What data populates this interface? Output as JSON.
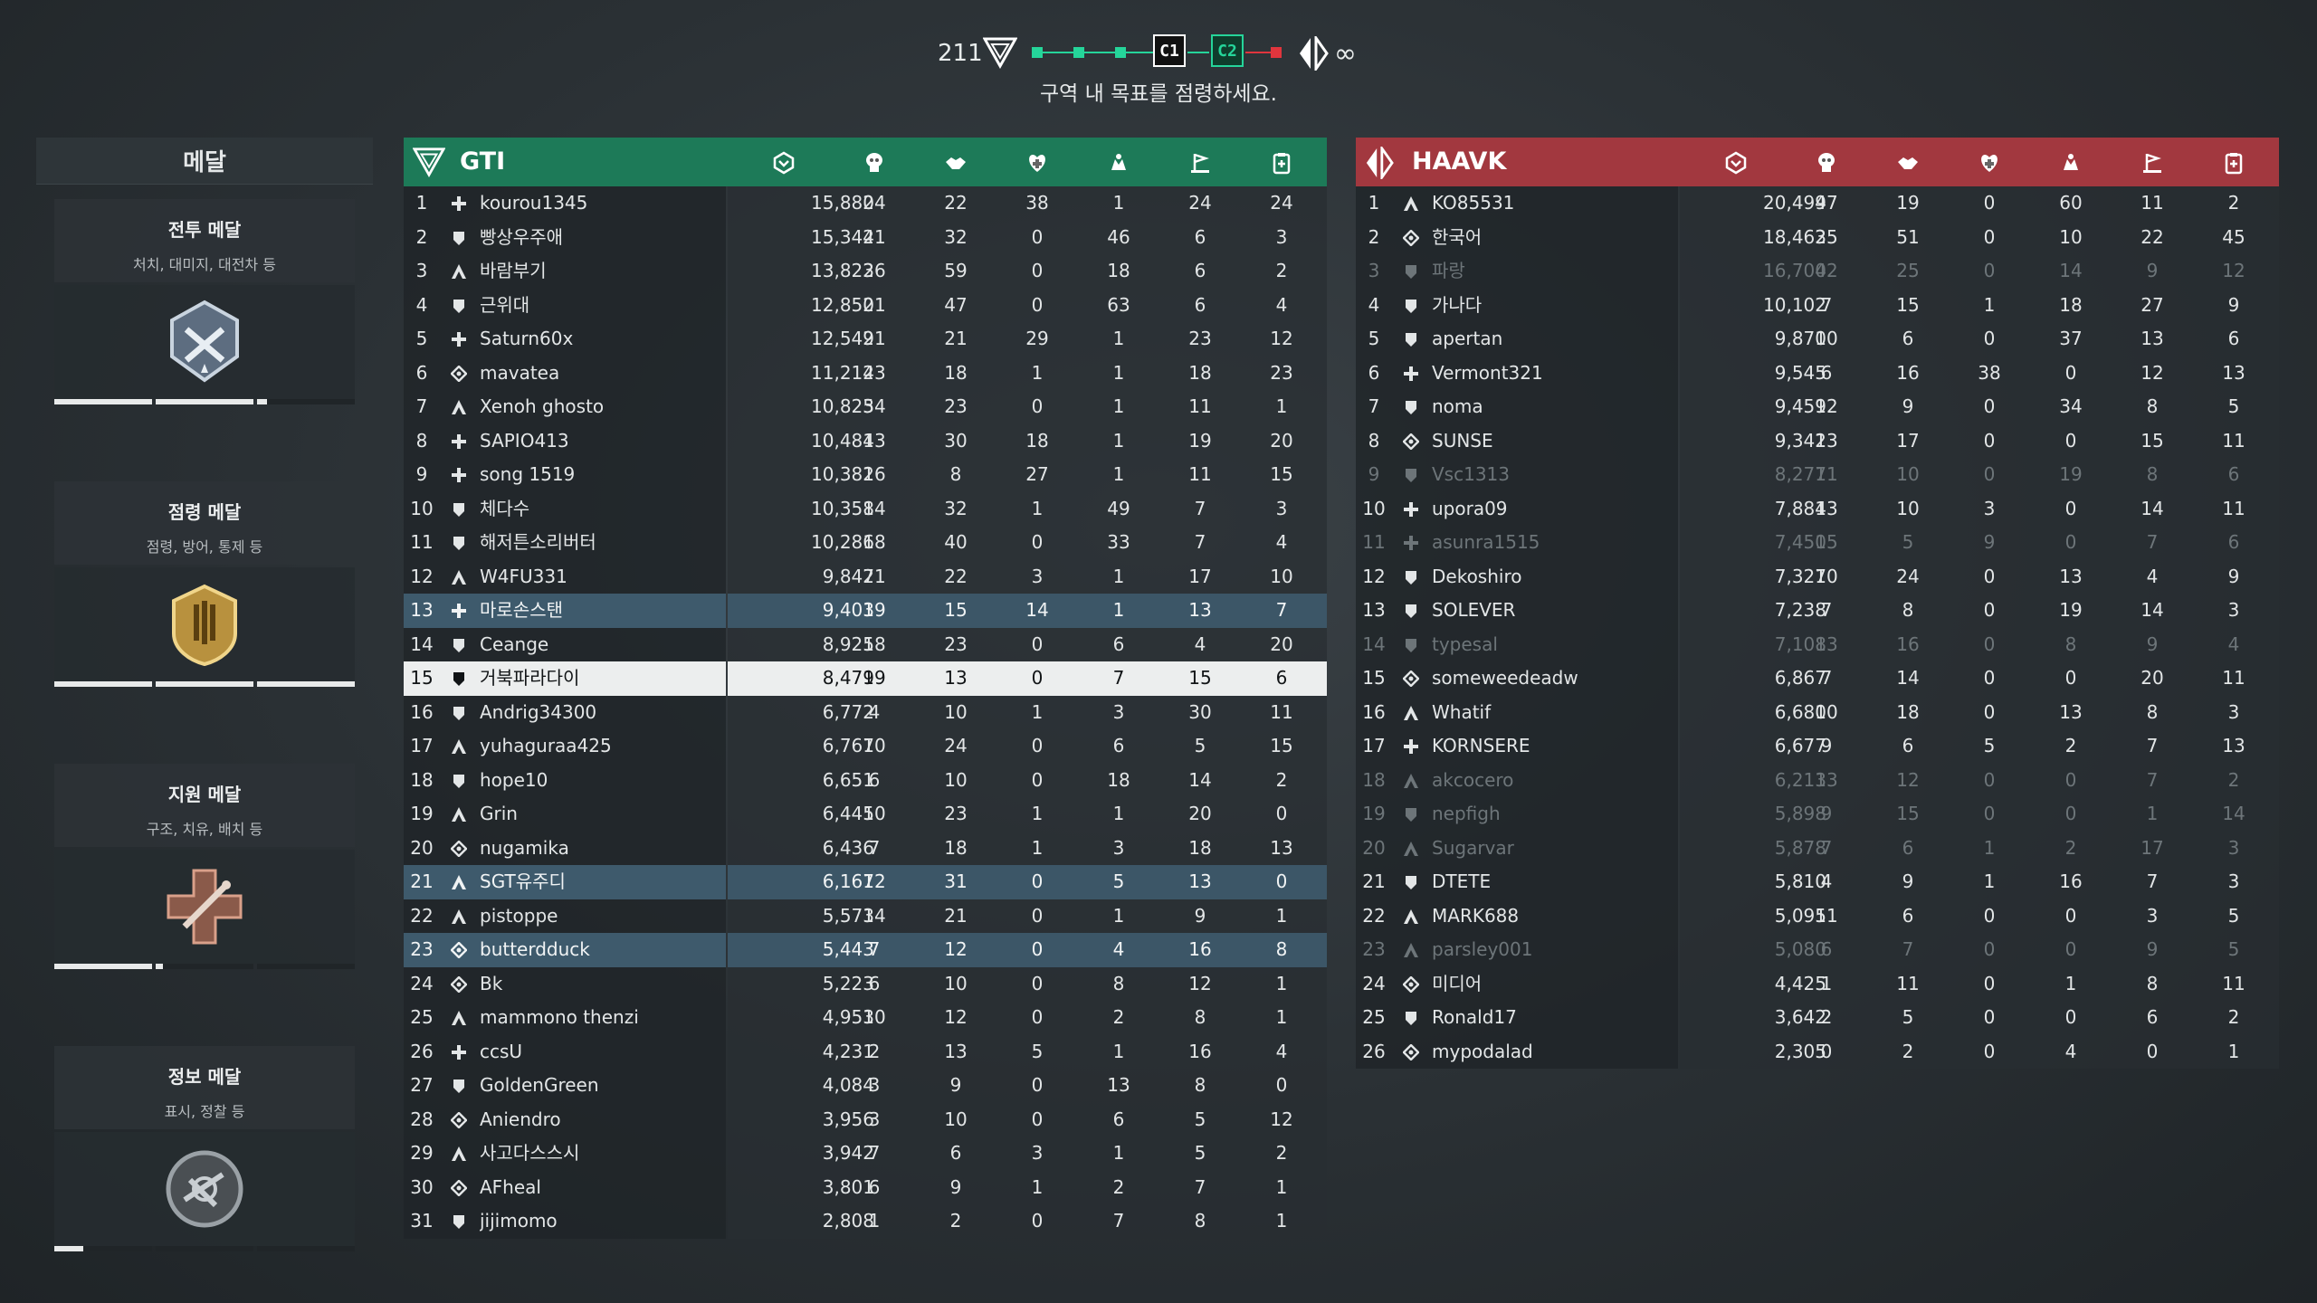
{
  "hud": {
    "our_tickets": "211",
    "enemy_tickets": "∞",
    "objectives": [
      "C1",
      "C2"
    ],
    "message": "구역 내 목표를 점령하세요.",
    "colors": {
      "friendly": "#25d59a",
      "enemy": "#e0353d"
    }
  },
  "medals": {
    "title": "메달",
    "cards": [
      {
        "title": "전투 메달",
        "sub": "처치, 대미지, 대전차 등",
        "icon": "combat-medal-icon",
        "progress": [
          1,
          1,
          0.1
        ]
      },
      {
        "title": "점령 메달",
        "sub": "점령, 방어, 통제 등",
        "icon": "objective-medal-icon",
        "progress": [
          1,
          1,
          1
        ]
      },
      {
        "title": "지원 메달",
        "sub": "구조, 치유, 배치 등",
        "icon": "support-medal-icon",
        "progress": [
          1,
          0.07,
          0
        ]
      },
      {
        "title": "정보 메달",
        "sub": "표시, 정찰 등",
        "icon": "intel-medal-icon",
        "progress": [
          0.3,
          0,
          0
        ]
      }
    ]
  },
  "columns": [
    "score-icon",
    "kills-icon",
    "assists-icon",
    "revives-icon",
    "deaths-icon",
    "objective-icon",
    "support-icon"
  ],
  "teams": [
    {
      "name": "GTI",
      "color": "#1d7a58",
      "players": [
        [
          "1",
          "medic",
          "kourou1345",
          "15,880",
          "24",
          "22",
          "38",
          "1",
          "24",
          "24"
        ],
        [
          "2",
          "engineer",
          "빵상우주애",
          "15,342",
          "41",
          "32",
          "0",
          "46",
          "6",
          "3"
        ],
        [
          "3",
          "assault",
          "바람부기",
          "13,822",
          "36",
          "59",
          "0",
          "18",
          "6",
          "2"
        ],
        [
          "4",
          "engineer",
          "근위대",
          "12,850",
          "21",
          "47",
          "0",
          "63",
          "6",
          "4"
        ],
        [
          "5",
          "medic",
          "Saturn60x",
          "12,549",
          "21",
          "21",
          "29",
          "1",
          "23",
          "12"
        ],
        [
          "6",
          "recon",
          "mavatea",
          "11,214",
          "23",
          "18",
          "1",
          "1",
          "18",
          "23"
        ],
        [
          "7",
          "assault",
          "Xenoh ghosto",
          "10,825",
          "34",
          "23",
          "0",
          "1",
          "11",
          "1"
        ],
        [
          "8",
          "medic",
          "SAPIO413",
          "10,484",
          "13",
          "30",
          "18",
          "1",
          "19",
          "20"
        ],
        [
          "9",
          "medic",
          "song 1519",
          "10,382",
          "16",
          "8",
          "27",
          "1",
          "11",
          "15"
        ],
        [
          "10",
          "engineer",
          "체다수",
          "10,358",
          "14",
          "32",
          "1",
          "49",
          "7",
          "3"
        ],
        [
          "11",
          "engineer",
          "해저튼소리버터",
          "10,286",
          "18",
          "40",
          "0",
          "33",
          "7",
          "4"
        ],
        [
          "12",
          "assault",
          "W4FU331",
          "9,847",
          "21",
          "22",
          "3",
          "1",
          "17",
          "10"
        ],
        [
          "13",
          "medic",
          "마로손스탠",
          "9,403",
          "19",
          "15",
          "14",
          "1",
          "13",
          "7"
        ],
        [
          "14",
          "engineer",
          "Ceange",
          "8,925",
          "18",
          "23",
          "0",
          "6",
          "4",
          "20"
        ],
        [
          "15",
          "engineer",
          "거북파라다이",
          "8,479",
          "19",
          "13",
          "0",
          "7",
          "15",
          "6"
        ],
        [
          "16",
          "engineer",
          "Andrig34300",
          "6,772",
          "4",
          "10",
          "1",
          "3",
          "30",
          "11"
        ],
        [
          "17",
          "assault",
          "yuhaguraa425",
          "6,767",
          "10",
          "24",
          "0",
          "6",
          "5",
          "15"
        ],
        [
          "18",
          "engineer",
          "hope10",
          "6,651",
          "6",
          "10",
          "0",
          "18",
          "14",
          "2"
        ],
        [
          "19",
          "assault",
          "Grin",
          "6,445",
          "10",
          "23",
          "1",
          "1",
          "20",
          "0"
        ],
        [
          "20",
          "recon",
          "nugamika",
          "6,436",
          "7",
          "18",
          "1",
          "3",
          "18",
          "13"
        ],
        [
          "21",
          "assault",
          "SGT유주디",
          "6,167",
          "12",
          "31",
          "0",
          "5",
          "13",
          "0"
        ],
        [
          "22",
          "assault",
          "pistoppe",
          "5,573",
          "14",
          "21",
          "0",
          "1",
          "9",
          "1"
        ],
        [
          "23",
          "recon",
          "butterdduck",
          "5,443",
          "7",
          "12",
          "0",
          "4",
          "16",
          "8"
        ],
        [
          "24",
          "recon",
          "Bk",
          "5,223",
          "6",
          "10",
          "0",
          "8",
          "12",
          "1"
        ],
        [
          "25",
          "assault",
          "mammono thenzi",
          "4,953",
          "10",
          "12",
          "0",
          "2",
          "8",
          "1"
        ],
        [
          "26",
          "medic",
          "ccsU",
          "4,231",
          "2",
          "13",
          "5",
          "1",
          "16",
          "4"
        ],
        [
          "27",
          "engineer",
          "GoldenGreen",
          "4,084",
          "3",
          "9",
          "0",
          "13",
          "8",
          "0"
        ],
        [
          "28",
          "recon",
          "Aniendro",
          "3,956",
          "3",
          "10",
          "0",
          "6",
          "5",
          "12"
        ],
        [
          "29",
          "assault",
          "사고다스스시",
          "3,942",
          "7",
          "6",
          "3",
          "1",
          "5",
          "2"
        ],
        [
          "30",
          "recon",
          "AFheal",
          "3,801",
          "6",
          "9",
          "1",
          "2",
          "7",
          "1"
        ],
        [
          "31",
          "engineer",
          "jijimomo",
          "2,808",
          "1",
          "2",
          "0",
          "7",
          "8",
          "1"
        ]
      ],
      "highlight_rows": [
        "13",
        "21",
        "23"
      ],
      "self_row": "15"
    },
    {
      "name": "HAAVK",
      "color": "#a2383f",
      "players": [
        [
          "1",
          "assault",
          "KO85531",
          "20,499",
          "47",
          "19",
          "0",
          "60",
          "11",
          "2"
        ],
        [
          "2",
          "recon",
          "한국어",
          "18,462",
          "35",
          "51",
          "0",
          "10",
          "22",
          "45"
        ],
        [
          "3",
          "engineer",
          "파랑",
          "16,700",
          "42",
          "25",
          "0",
          "14",
          "9",
          "12"
        ],
        [
          "4",
          "engineer",
          "가나다",
          "10,102",
          "7",
          "15",
          "1",
          "18",
          "27",
          "9"
        ],
        [
          "5",
          "engineer",
          "apertan",
          "9,870",
          "10",
          "6",
          "0",
          "37",
          "13",
          "6"
        ],
        [
          "6",
          "medic",
          "Vermont321",
          "9,545",
          "6",
          "16",
          "38",
          "0",
          "12",
          "13"
        ],
        [
          "7",
          "engineer",
          "noma",
          "9,459",
          "12",
          "9",
          "0",
          "34",
          "8",
          "5"
        ],
        [
          "8",
          "recon",
          "SUNSE",
          "9,341",
          "23",
          "17",
          "0",
          "0",
          "15",
          "11"
        ],
        [
          "9",
          "engineer",
          "Vsc1313",
          "8,277",
          "11",
          "10",
          "0",
          "19",
          "8",
          "6"
        ],
        [
          "10",
          "medic",
          "upora09",
          "7,884",
          "13",
          "10",
          "3",
          "0",
          "14",
          "11"
        ],
        [
          "11",
          "medic",
          "asunra1515",
          "7,450",
          "15",
          "5",
          "9",
          "0",
          "7",
          "6"
        ],
        [
          "12",
          "engineer",
          "Dekoshiro",
          "7,327",
          "10",
          "24",
          "0",
          "13",
          "4",
          "9"
        ],
        [
          "13",
          "engineer",
          "SOLEVER",
          "7,238",
          "7",
          "8",
          "0",
          "19",
          "14",
          "3"
        ],
        [
          "14",
          "engineer",
          "typesal",
          "7,108",
          "13",
          "16",
          "0",
          "8",
          "9",
          "4"
        ],
        [
          "15",
          "recon",
          "someweedeadw",
          "6,867",
          "7",
          "14",
          "0",
          "0",
          "20",
          "11"
        ],
        [
          "16",
          "assault",
          "Whatif",
          "6,680",
          "10",
          "18",
          "0",
          "13",
          "8",
          "3"
        ],
        [
          "17",
          "medic",
          "KORNSERE",
          "6,677",
          "9",
          "6",
          "5",
          "2",
          "7",
          "13"
        ],
        [
          "18",
          "assault",
          "akcocero",
          "6,213",
          "13",
          "12",
          "0",
          "0",
          "7",
          "2"
        ],
        [
          "19",
          "engineer",
          "nepfigh",
          "5,898",
          "9",
          "15",
          "0",
          "0",
          "1",
          "14"
        ],
        [
          "20",
          "assault",
          "Sugarvar",
          "5,878",
          "7",
          "6",
          "1",
          "2",
          "17",
          "3"
        ],
        [
          "21",
          "engineer",
          "DTETE",
          "5,810",
          "4",
          "9",
          "1",
          "16",
          "7",
          "3"
        ],
        [
          "22",
          "assault",
          "MARK688",
          "5,095",
          "11",
          "6",
          "0",
          "0",
          "3",
          "5"
        ],
        [
          "23",
          "assault",
          "parsley001",
          "5,080",
          "6",
          "7",
          "0",
          "0",
          "9",
          "5"
        ],
        [
          "24",
          "recon",
          "미디어",
          "4,425",
          "1",
          "11",
          "0",
          "1",
          "8",
          "11"
        ],
        [
          "25",
          "engineer",
          "Ronald17",
          "3,642",
          "2",
          "5",
          "0",
          "0",
          "6",
          "2"
        ],
        [
          "26",
          "recon",
          "mypodalad",
          "2,305",
          "0",
          "2",
          "0",
          "4",
          "0",
          "1"
        ]
      ],
      "dim_rows": [
        "3",
        "9",
        "11",
        "14",
        "18",
        "19",
        "20",
        "23"
      ]
    }
  ]
}
